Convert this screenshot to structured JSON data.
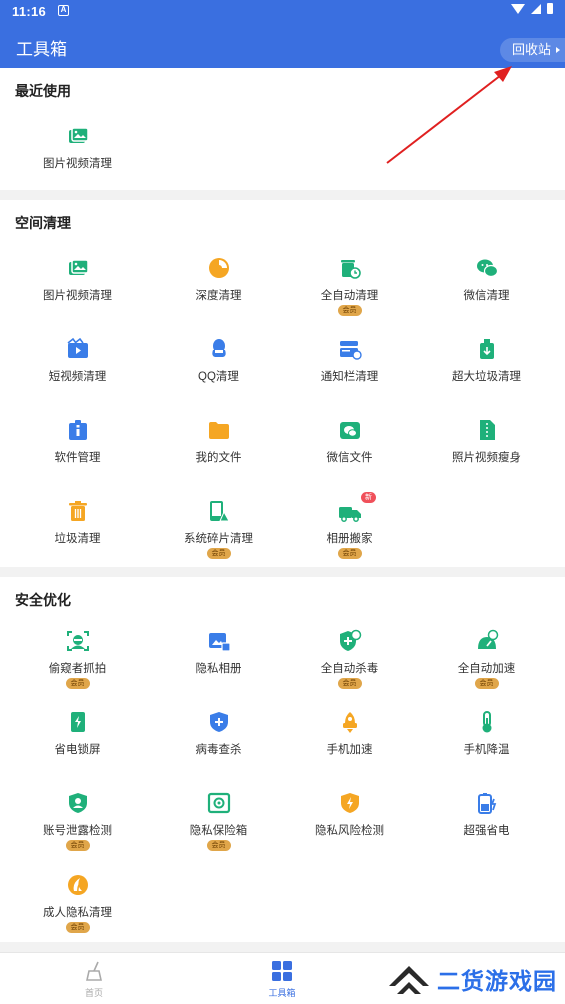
{
  "status_bar": {
    "time": "11:16",
    "notification_glyph": "A"
  },
  "header": {
    "title": "工具箱",
    "recycle_label": "回收站"
  },
  "badges": {
    "member": "会员",
    "new": "新"
  },
  "recent": {
    "title": "最近使用",
    "items": [
      {
        "label": "图片视频清理",
        "icon": "photo-video-icon"
      }
    ]
  },
  "space": {
    "title": "空间清理",
    "items": [
      {
        "label": "图片视频清理",
        "icon": "photo-video-icon"
      },
      {
        "label": "深度清理",
        "icon": "deep-clean-icon"
      },
      {
        "label": "全自动清理",
        "icon": "auto-clean-icon",
        "member": true
      },
      {
        "label": "微信清理",
        "icon": "wechat-icon"
      },
      {
        "label": "短视频清理",
        "icon": "short-video-icon"
      },
      {
        "label": "QQ清理",
        "icon": "qq-icon"
      },
      {
        "label": "通知栏清理",
        "icon": "notification-bar-icon"
      },
      {
        "label": "超大垃圾清理",
        "icon": "large-file-icon"
      },
      {
        "label": "软件管理",
        "icon": "app-manager-icon"
      },
      {
        "label": "我的文件",
        "icon": "folder-icon"
      },
      {
        "label": "微信文件",
        "icon": "wechat-file-icon"
      },
      {
        "label": "照片视频瘦身",
        "icon": "compress-icon"
      },
      {
        "label": "垃圾清理",
        "icon": "trash-icon"
      },
      {
        "label": "系统碎片清理",
        "icon": "fragment-icon",
        "member": true
      },
      {
        "label": "相册搬家",
        "icon": "album-move-icon",
        "member": true,
        "new": true
      }
    ]
  },
  "security": {
    "title": "安全优化",
    "items": [
      {
        "label": "偷窥者抓拍",
        "icon": "peeker-capture-icon",
        "member": true
      },
      {
        "label": "隐私相册",
        "icon": "private-album-icon"
      },
      {
        "label": "全自动杀毒",
        "icon": "auto-antivirus-icon",
        "member": true
      },
      {
        "label": "全自动加速",
        "icon": "auto-speedup-icon",
        "member": true
      },
      {
        "label": "省电锁屏",
        "icon": "power-lock-icon"
      },
      {
        "label": "病毒查杀",
        "icon": "virus-scan-icon"
      },
      {
        "label": "手机加速",
        "icon": "rocket-icon"
      },
      {
        "label": "手机降温",
        "icon": "thermometer-icon"
      },
      {
        "label": "账号泄露检测",
        "icon": "account-leak-icon",
        "member": true
      },
      {
        "label": "隐私保险箱",
        "icon": "safe-box-icon",
        "member": true
      },
      {
        "label": "隐私风险检测",
        "icon": "privacy-risk-icon"
      },
      {
        "label": "超强省电",
        "icon": "battery-saver-icon"
      },
      {
        "label": "成人隐私清理",
        "icon": "adult-privacy-icon",
        "member": true
      }
    ]
  },
  "bottom_nav": [
    {
      "label": "首页",
      "icon": "home-broom-icon",
      "active": false
    },
    {
      "label": "工具箱",
      "icon": "toolbox-grid-icon",
      "active": true
    }
  ],
  "watermark": "二货游戏园",
  "colors": {
    "primary": "#3a6fe0",
    "green": "#1fb07a",
    "orange": "#f5a623",
    "blue": "#3a7de8",
    "badge": "#e0a64a"
  }
}
